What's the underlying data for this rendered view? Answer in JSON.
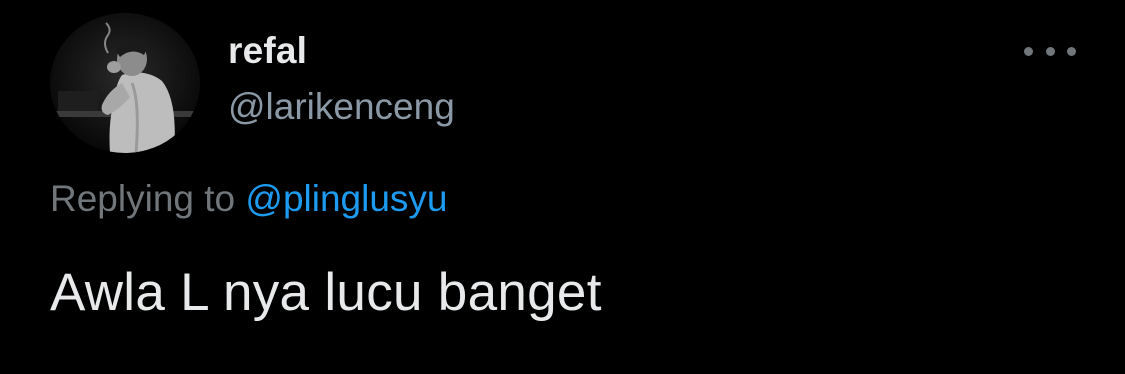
{
  "tweet": {
    "author": {
      "display_name": "refal",
      "handle": "@larikenceng",
      "avatar_icon": "profile-photo"
    },
    "more_icon": "more-options-icon",
    "reply": {
      "prefix": "Replying to",
      "mention": "@plinglusyu"
    },
    "text": "Awla L nya lucu banget"
  },
  "colors": {
    "background": "#000000",
    "primary_text": "#e7e9ea",
    "secondary_text": "#71767b",
    "link": "#1d9bf0"
  }
}
